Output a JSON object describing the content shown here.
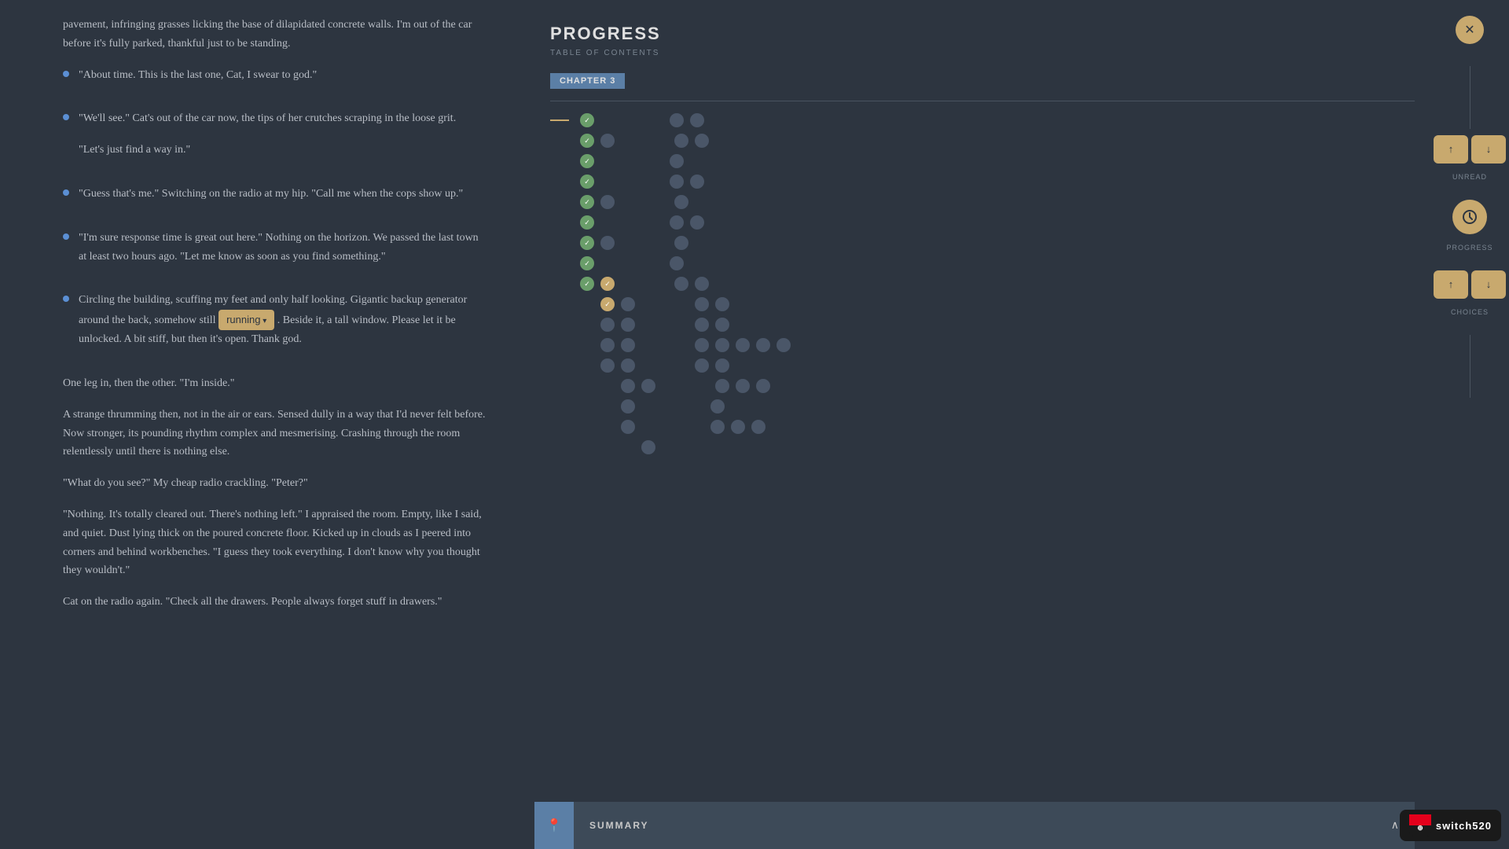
{
  "reading": {
    "intro_text": "pavement, infringing grasses licking the base of dilapidated concrete walls. I'm out of the car before it's fully parked, thankful just to be standing.",
    "bullet1": "\"About time. This is the last one, Cat, I swear to god.\"",
    "bullet2_a": "\"We'll see.\" Cat's out of the car now, the tips of her crutches scraping in the loose grit.",
    "bullet2_b": "\"Let's just find a way in.\"",
    "bullet3": "\"Guess that's me.\" Switching on the radio at my hip. \"Call me when the cops show up.\"",
    "bullet4": "\"I'm sure response time is great out here.\" Nothing on the horizon. We passed the last town at least two hours ago. \"Let me know as soon as you find something.\"",
    "bullet5_a": "Circling the building, scuffing my feet and only half looking. Gigantic backup generator around the back, somehow still",
    "running_badge": "running",
    "bullet5_b": ". Beside it, a tall window. Please let it be unlocked. A bit stiff, but then it's open. Thank god.",
    "para1": "One leg in, then the other. \"I'm inside.\"",
    "para2": "A strange thrumming then, not in the air or ears. Sensed dully in a way that I'd never felt before. Now stronger, its pounding rhythm complex and mesmerising. Crashing through the room relentlessly until there is nothing else.",
    "para3": "\"What do you see?\" My cheap radio crackling. \"Peter?\"",
    "para4": "\"Nothing. It's totally cleared out. There's nothing left.\" I appraised the room. Empty, like I said, and quiet. Dust lying thick on the poured concrete floor. Kicked up in clouds as I peered into corners and behind workbenches. \"I guess they took everything. I don't know why you thought they wouldn't.\"",
    "para5": "Cat on the radio again. \"Check all the drawers. People always forget stuff in drawers.\""
  },
  "progress": {
    "title": "PROGRESS",
    "subtitle": "TABLE OF CONTENTS",
    "chapter_label": "CHAPTER 3"
  },
  "summary": {
    "label": "SUMMARY",
    "pin_icon": "📍"
  },
  "sidebar": {
    "unread_label": "UNREAD",
    "progress_label": "PROGRESS",
    "choices_label": "CHOICES"
  },
  "branding": {
    "text": "switch520"
  }
}
